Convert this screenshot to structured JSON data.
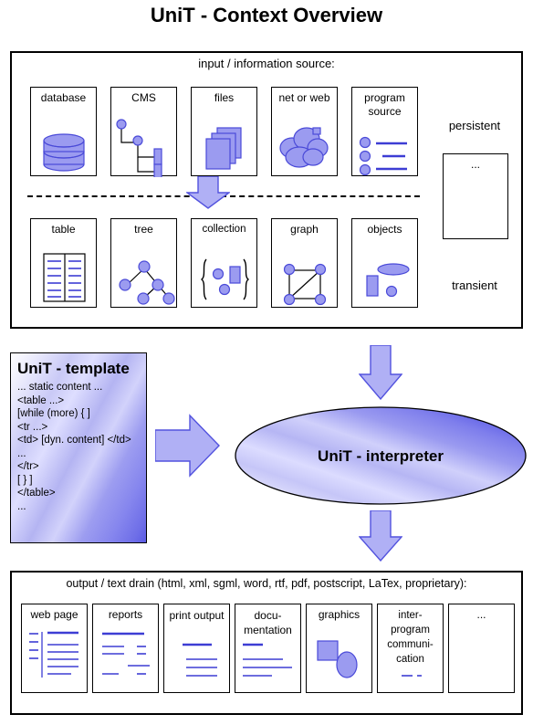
{
  "page": {
    "title": "UniT - Context Overview"
  },
  "input_section": {
    "caption": "input / information source:",
    "sources": [
      {
        "label": "database",
        "icon": "database-cylinder-icon"
      },
      {
        "label": "CMS",
        "icon": "tree-hierarchy-icon"
      },
      {
        "label": "files",
        "icon": "stacked-files-icon"
      },
      {
        "label": "net or web",
        "icon": "cloud-network-icon"
      },
      {
        "label": "program source",
        "icon": "bullet-list-icon"
      }
    ],
    "structures": [
      {
        "label": "table",
        "icon": "two-column-table-icon"
      },
      {
        "label": "tree",
        "icon": "node-tree-icon"
      },
      {
        "label": "collection",
        "icon": "braces-collection-icon"
      },
      {
        "label": "graph",
        "icon": "graph-nodes-icon"
      },
      {
        "label": "objects",
        "icon": "shapes-objects-icon"
      }
    ],
    "side": {
      "persistent_label": "persistent",
      "transient_label": "transient",
      "ellipsis_box_label": "..."
    }
  },
  "template_box": {
    "title": "UniT - template",
    "lines": [
      "... static content ...",
      "<table ...>",
      "[while (more) { ]",
      "<tr ...>",
      "<td> [dyn. content] </td>",
      "...",
      "</tr>",
      "[ } ]",
      "</table>",
      "..."
    ]
  },
  "interpreter": {
    "label": "UniT - interpreter"
  },
  "output_section": {
    "caption": "output / text drain (html, xml, sgml, word, rtf, pdf, postscript, LaTex, proprietary):",
    "targets": [
      {
        "label": "web page",
        "icon": "web-page-layout-icon"
      },
      {
        "label": "reports",
        "icon": "report-lines-icon"
      },
      {
        "label": "print output",
        "icon": "print-lines-icon"
      },
      {
        "label": "docu- mentation",
        "icon": "doc-lines-icon"
      },
      {
        "label": "graphics",
        "icon": "shapes-graphics-icon"
      },
      {
        "label": "inter- program communi- cation",
        "icon": "ipc-lines-icon"
      },
      {
        "label": "...",
        "icon": "empty-icon"
      }
    ]
  },
  "arrows": {
    "input_to_structures": "down-arrow",
    "input_to_interpreter": "down-arrow",
    "template_to_interpreter": "right-arrow",
    "interpreter_to_output": "down-arrow"
  },
  "colors": {
    "glyph_fill": "#9b9bf0",
    "glyph_stroke": "#3d3dd4",
    "arrow_fill": "#b0b0f5",
    "arrow_stroke": "#5252de",
    "frame": "#000000",
    "background": "#ffffff"
  }
}
